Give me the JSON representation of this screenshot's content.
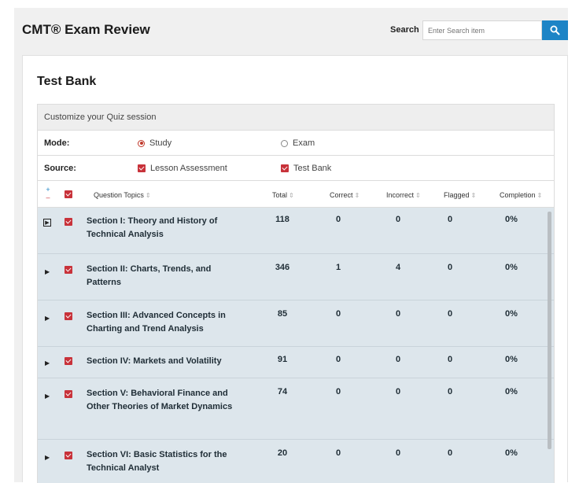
{
  "header": {
    "app_title": "CMT® Exam Review",
    "search_label": "Search",
    "search_placeholder": "Enter Search item"
  },
  "card": {
    "title": "Test Bank",
    "customize_label": "Customize your Quiz session",
    "mode": {
      "label": "Mode:",
      "options": [
        {
          "label": "Study",
          "selected": true
        },
        {
          "label": "Exam",
          "selected": false
        }
      ]
    },
    "source": {
      "label": "Source:",
      "options": [
        {
          "label": "Lesson Assessment",
          "checked": true
        },
        {
          "label": "Test Bank",
          "checked": true
        }
      ]
    }
  },
  "table": {
    "columns": [
      "Question Topics",
      "Total",
      "Correct",
      "Incorrect",
      "Flagged",
      "Completion"
    ],
    "sort_icon": "⇕",
    "rows": [
      {
        "topic": "Section I: Theory and History of Technical Analysis",
        "total": "118",
        "correct": "0",
        "incorrect": "0",
        "flagged": "0",
        "completion": "0%",
        "checked": true
      },
      {
        "topic": "Section II: Charts, Trends, and Patterns",
        "total": "346",
        "correct": "1",
        "incorrect": "4",
        "flagged": "0",
        "completion": "0%",
        "checked": true
      },
      {
        "topic": "Section III: Advanced Concepts in Charting and Trend Analysis",
        "total": "85",
        "correct": "0",
        "incorrect": "0",
        "flagged": "0",
        "completion": "0%",
        "checked": true
      },
      {
        "topic": "Section IV: Markets and Volatility",
        "total": "91",
        "correct": "0",
        "incorrect": "0",
        "flagged": "0",
        "completion": "0%",
        "checked": true
      },
      {
        "topic": "Section V: Behavioral Finance and Other Theories of Market Dynamics",
        "total": "74",
        "correct": "0",
        "incorrect": "0",
        "flagged": "0",
        "completion": "0%",
        "checked": true
      },
      {
        "topic": "Section VI: Basic Statistics for the Technical Analyst",
        "total": "20",
        "correct": "0",
        "incorrect": "0",
        "flagged": "0",
        "completion": "0%",
        "checked": true
      }
    ]
  },
  "colors": {
    "accent": "#1d84c6",
    "checkbox": "#c8323a",
    "row_background": "#dde6ec"
  }
}
